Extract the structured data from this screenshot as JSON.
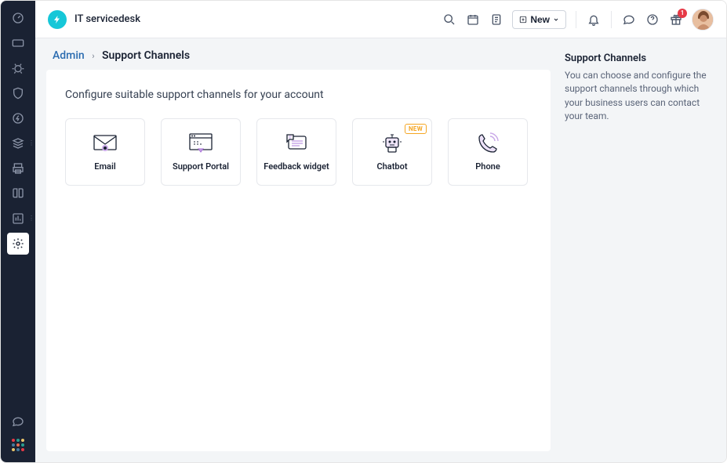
{
  "brand": {
    "title": "IT servicedesk"
  },
  "topbar": {
    "new_label": "New",
    "gift_badge": "1"
  },
  "breadcrumb": {
    "root": "Admin",
    "current": "Support Channels"
  },
  "panel": {
    "description": "Configure suitable support channels for your account"
  },
  "channels": {
    "email": {
      "label": "Email"
    },
    "portal": {
      "label": "Support Portal"
    },
    "feedback": {
      "label": "Feedback widget"
    },
    "chatbot": {
      "label": "Chatbot",
      "tag": "NEW"
    },
    "phone": {
      "label": "Phone"
    }
  },
  "info": {
    "title": "Support Channels",
    "text": "You can choose and configure the support channels through which your business users can contact your team."
  }
}
